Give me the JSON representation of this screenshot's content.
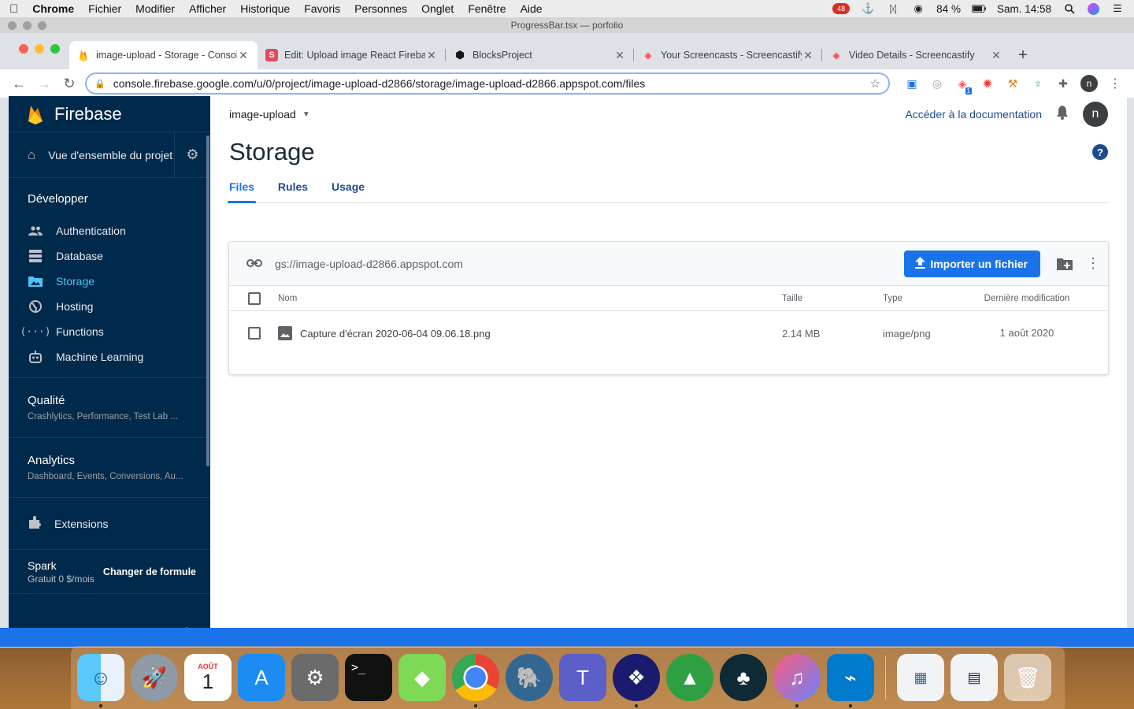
{
  "menubar": {
    "app": "Chrome",
    "items": [
      "Fichier",
      "Modifier",
      "Afficher",
      "Historique",
      "Favoris",
      "Personnes",
      "Onglet",
      "Fenêtre",
      "Aide"
    ],
    "battery": "84 %",
    "clock": "Sam. 14:58",
    "badge_count": "48"
  },
  "window": {
    "title": "ProgressBar.tsx — porfolio"
  },
  "browser": {
    "tabs": [
      {
        "title": "image-upload - Storage - Console Firebase",
        "favicon": "firebase-icon",
        "active": true
      },
      {
        "title": "Edit: Upload image React Firebase",
        "favicon": "s-icon",
        "active": false
      },
      {
        "title": "BlocksProject",
        "favicon": "codesandbox-icon",
        "active": false
      },
      {
        "title": "Your Screencasts - Screencastify",
        "favicon": "screencastify-icon",
        "active": false
      },
      {
        "title": "Video Details - Screencastify",
        "favicon": "screencastify-icon",
        "active": false
      }
    ],
    "url": "console.firebase.google.com/u/0/project/image-upload-d2866/storage/image-upload-d2866.appspot.com/files",
    "profile_initial": "n",
    "ext_badge": "1"
  },
  "sidebar": {
    "brand": "Firebase",
    "overview": "Vue d'ensemble du projet",
    "develop_heading": "Développer",
    "items": [
      {
        "label": "Authentication",
        "icon": "people-icon",
        "active": false
      },
      {
        "label": "Database",
        "icon": "database-icon",
        "active": false
      },
      {
        "label": "Storage",
        "icon": "photo-folder-icon",
        "active": true
      },
      {
        "label": "Hosting",
        "icon": "globe-icon",
        "active": false
      },
      {
        "label": "Functions",
        "icon": "functions-icon",
        "active": false
      },
      {
        "label": "Machine Learning",
        "icon": "robot-icon",
        "active": false
      }
    ],
    "groups": [
      {
        "title": "Qualité",
        "subtitle": "Crashlytics, Performance, Test Lab ..."
      },
      {
        "title": "Analytics",
        "subtitle": "Dashboard, Events, Conversions, Au..."
      }
    ],
    "extensions": "Extensions",
    "plan": {
      "name": "Spark",
      "price": "Gratuit 0 $/mois",
      "button": "Changer de formule"
    }
  },
  "header": {
    "project": "image-upload",
    "docs_link": "Accéder à la documentation",
    "avatar_initial": "n"
  },
  "page": {
    "title": "Storage",
    "tabs": [
      {
        "label": "Files",
        "active": true
      },
      {
        "label": "Rules",
        "active": false
      },
      {
        "label": "Usage",
        "active": false
      }
    ]
  },
  "storage": {
    "bucket": "gs://image-upload-d2866.appspot.com",
    "upload_button": "Importer un fichier",
    "columns": {
      "name": "Nom",
      "size": "Taille",
      "type": "Type",
      "modified": "Dernière modification"
    },
    "rows": [
      {
        "name": "Capture d'écran 2020-06-04 09.06.18.png",
        "size": "2.14 MB",
        "type": "image/png",
        "modified": "1 août 2020"
      }
    ]
  },
  "dock": {
    "calendar_month": "AOÛT",
    "calendar_day": "1",
    "apps": [
      "Finder",
      "Launchpad",
      "Calendar",
      "App Store",
      "System Preferences",
      "Terminal",
      "Cube",
      "Chrome",
      "PostgreSQL",
      "Teams",
      "Dropbox",
      "Robo",
      "GitKraken",
      "Music",
      "VS Code",
      "Window 1",
      "Window 2",
      "Trash"
    ]
  },
  "colors": {
    "accent": "#1a73e8",
    "sidebar_bg": "#002a4c",
    "active_item": "#4fc3f7"
  }
}
